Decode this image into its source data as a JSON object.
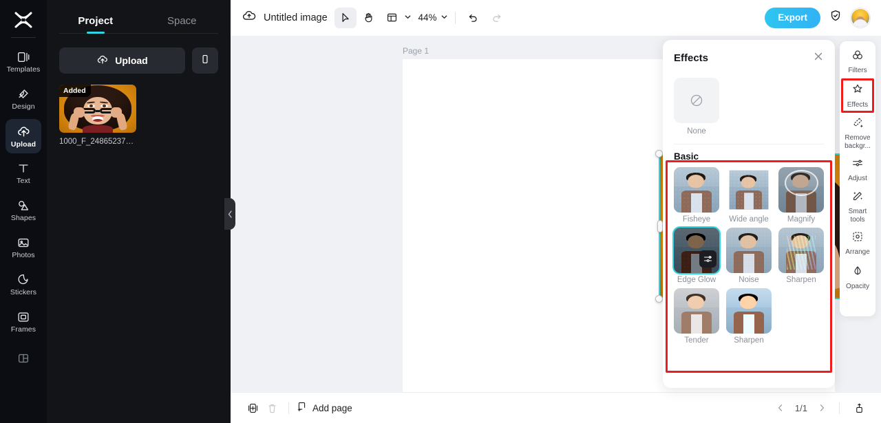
{
  "left_rail": {
    "logo": "capcut-logo",
    "items": [
      {
        "label": "Templates",
        "icon": "templates-icon",
        "active": false
      },
      {
        "label": "Design",
        "icon": "design-icon",
        "active": false
      },
      {
        "label": "Upload",
        "icon": "upload-cloud-icon",
        "active": true
      },
      {
        "label": "Text",
        "icon": "text-icon",
        "active": false
      },
      {
        "label": "Shapes",
        "icon": "shapes-icon",
        "active": false
      },
      {
        "label": "Photos",
        "icon": "photos-icon",
        "active": false
      },
      {
        "label": "Stickers",
        "icon": "stickers-icon",
        "active": false
      },
      {
        "label": "Frames",
        "icon": "frames-icon",
        "active": false
      },
      {
        "label": "",
        "icon": "layout-grid-icon",
        "active": false
      }
    ]
  },
  "project_panel": {
    "tabs": [
      {
        "label": "Project",
        "active": true
      },
      {
        "label": "Space",
        "active": false
      }
    ],
    "upload_label": "Upload",
    "upload_icon": "upload-cloud-icon",
    "mobile_upload_icon": "mobile-phone-icon",
    "assets": [
      {
        "badge": "Added",
        "name": "1000_F_248652378..."
      }
    ]
  },
  "topbar": {
    "cloud_icon": "cloud-save-icon",
    "doc_title": "Untitled image",
    "title_chevron": "chevron-down-icon",
    "tools": [
      {
        "name": "select-tool",
        "icon": "cursor-arrow-icon",
        "active": true
      },
      {
        "name": "hand-tool",
        "icon": "hand-icon",
        "active": false
      }
    ],
    "layout_icon": "layout-panel-icon",
    "layout_chevron": "chevron-down-icon",
    "zoom_level": "44%",
    "zoom_chevron": "chevron-down-icon",
    "undo_icon": "undo-arrow-icon",
    "redo_icon": "redo-arrow-icon",
    "export_label": "Export",
    "shield_icon": "shield-check-icon",
    "avatar": "user-avatar"
  },
  "canvas": {
    "page_label": "Page 1",
    "object_toolbar": [
      {
        "name": "crop-button",
        "icon": "crop-icon"
      },
      {
        "name": "replace-button",
        "icon": "replace-swap-icon"
      },
      {
        "name": "duplicate-button",
        "icon": "add-layer-icon"
      },
      {
        "name": "more-button",
        "icon": "more-dots-icon"
      }
    ],
    "rotate_icon": "rotate-icon",
    "selection_color": "#2fd8e0"
  },
  "effects_panel": {
    "title": "Effects",
    "close_icon": "close-icon",
    "none": {
      "label": "None",
      "icon": "no-effect-icon"
    },
    "section_title": "Basic",
    "effects": [
      {
        "label": "Fisheye",
        "selected": false,
        "style": "fisheye"
      },
      {
        "label": "Wide angle",
        "selected": false,
        "style": "wide"
      },
      {
        "label": "Magnify",
        "selected": false,
        "style": "magnify"
      },
      {
        "label": "Edge Glow",
        "selected": true,
        "style": "edgeglow",
        "badge": "adjust-icon"
      },
      {
        "label": "Noise",
        "selected": false,
        "style": "noise"
      },
      {
        "label": "Sharpen",
        "selected": false,
        "style": "rainbow"
      },
      {
        "label": "Tender",
        "selected": false,
        "style": "tender"
      },
      {
        "label": "Sharpen",
        "selected": false,
        "style": "sharpen"
      }
    ]
  },
  "right_rail": {
    "items": [
      {
        "label": "Filters",
        "icon": "filters-icon",
        "active": false
      },
      {
        "label": "Effects",
        "icon": "effects-star-icon",
        "active": true
      },
      {
        "label": "Remove backgr...",
        "icon": "remove-bg-icon",
        "active": false
      },
      {
        "label": "Adjust",
        "icon": "adjust-sliders-icon",
        "active": false
      },
      {
        "label": "Smart tools",
        "icon": "smart-wand-icon",
        "active": false
      },
      {
        "label": "Arrange",
        "icon": "arrange-icon",
        "active": false
      },
      {
        "label": "Opacity",
        "icon": "opacity-drop-icon",
        "active": false
      }
    ]
  },
  "bottombar": {
    "duplicate_page_icon": "duplicate-page-icon",
    "delete_page_icon": "trash-icon",
    "add_page_label": "Add page",
    "add_page_icon": "add-page-icon",
    "prev_icon": "chevron-left-icon",
    "page_indicator": "1/1",
    "next_icon": "chevron-right-icon",
    "export_page_icon": "export-page-icon"
  },
  "annotations": {
    "highlight_color": "#ee1c1c",
    "boxes": [
      "effects-rail-button",
      "basic-effects-section"
    ]
  }
}
